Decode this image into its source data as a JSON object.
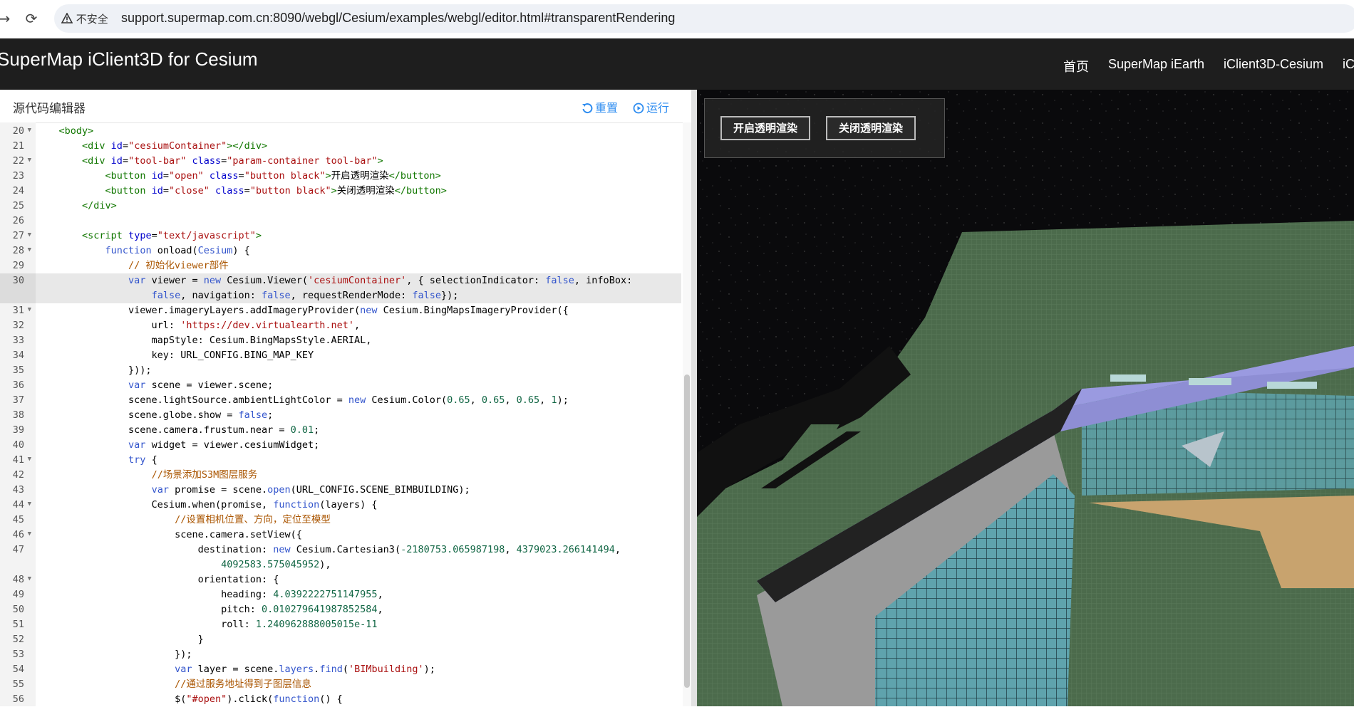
{
  "browser": {
    "security_label": "不安全",
    "url": "support.supermap.com.cn:8090/webgl/Cesium/examples/webgl/editor.html#transparentRendering"
  },
  "header": {
    "title": "SuperMap iClient3D for Cesium",
    "nav": [
      "首页",
      "SuperMap iEarth",
      "iClient3D-Cesium",
      "iC"
    ]
  },
  "editor": {
    "title": "源代码编辑器",
    "reset_label": "重置",
    "run_label": "运行",
    "gutter": [
      {
        "n": "20",
        "fold": true
      },
      {
        "n": "21",
        "fold": false
      },
      {
        "n": "22",
        "fold": true
      },
      {
        "n": "23",
        "fold": false
      },
      {
        "n": "24",
        "fold": false
      },
      {
        "n": "25",
        "fold": false
      },
      {
        "n": "26",
        "fold": false
      },
      {
        "n": "27",
        "fold": true
      },
      {
        "n": "28",
        "fold": true
      },
      {
        "n": "29",
        "fold": false
      },
      {
        "n": "30",
        "fold": false,
        "active": true
      },
      {
        "n": "",
        "fold": false,
        "active": true
      },
      {
        "n": "31",
        "fold": true
      },
      {
        "n": "32",
        "fold": false
      },
      {
        "n": "33",
        "fold": false
      },
      {
        "n": "34",
        "fold": false
      },
      {
        "n": "35",
        "fold": false
      },
      {
        "n": "36",
        "fold": false
      },
      {
        "n": "37",
        "fold": false
      },
      {
        "n": "38",
        "fold": false
      },
      {
        "n": "39",
        "fold": false
      },
      {
        "n": "40",
        "fold": false
      },
      {
        "n": "41",
        "fold": true
      },
      {
        "n": "42",
        "fold": false
      },
      {
        "n": "43",
        "fold": false
      },
      {
        "n": "44",
        "fold": true
      },
      {
        "n": "45",
        "fold": false
      },
      {
        "n": "46",
        "fold": true
      },
      {
        "n": "47",
        "fold": false
      },
      {
        "n": "",
        "fold": false
      },
      {
        "n": "48",
        "fold": true
      },
      {
        "n": "49",
        "fold": false
      },
      {
        "n": "50",
        "fold": false
      },
      {
        "n": "51",
        "fold": false
      },
      {
        "n": "52",
        "fold": false
      },
      {
        "n": "53",
        "fold": false
      },
      {
        "n": "54",
        "fold": false
      },
      {
        "n": "55",
        "fold": false
      },
      {
        "n": "56",
        "fold": false
      }
    ],
    "lines": [
      [
        [
          "t",
          "    "
        ],
        [
          "g",
          "<body>"
        ]
      ],
      [
        [
          "t",
          "        "
        ],
        [
          "g",
          "<div "
        ],
        [
          "b",
          "id"
        ],
        [
          "t",
          "="
        ],
        [
          "s",
          "\"cesiumContainer\""
        ],
        [
          "g",
          "></div>"
        ]
      ],
      [
        [
          "t",
          "        "
        ],
        [
          "g",
          "<div "
        ],
        [
          "b",
          "id"
        ],
        [
          "t",
          "="
        ],
        [
          "s",
          "\"tool-bar\""
        ],
        [
          "t",
          " "
        ],
        [
          "b",
          "class"
        ],
        [
          "t",
          "="
        ],
        [
          "s",
          "\"param-container tool-bar\""
        ],
        [
          "g",
          ">"
        ]
      ],
      [
        [
          "t",
          "            "
        ],
        [
          "g",
          "<button "
        ],
        [
          "b",
          "id"
        ],
        [
          "t",
          "="
        ],
        [
          "s",
          "\"open\""
        ],
        [
          "t",
          " "
        ],
        [
          "b",
          "class"
        ],
        [
          "t",
          "="
        ],
        [
          "s",
          "\"button black\""
        ],
        [
          "g",
          ">"
        ],
        [
          "t",
          "开启透明渲染"
        ],
        [
          "g",
          "</button>"
        ]
      ],
      [
        [
          "t",
          "            "
        ],
        [
          "g",
          "<button "
        ],
        [
          "b",
          "id"
        ],
        [
          "t",
          "="
        ],
        [
          "s",
          "\"close\""
        ],
        [
          "t",
          " "
        ],
        [
          "b",
          "class"
        ],
        [
          "t",
          "="
        ],
        [
          "s",
          "\"button black\""
        ],
        [
          "g",
          ">"
        ],
        [
          "t",
          "关闭透明渲染"
        ],
        [
          "g",
          "</button>"
        ]
      ],
      [
        [
          "t",
          "        "
        ],
        [
          "g",
          "</div>"
        ]
      ],
      [
        [
          "t",
          ""
        ]
      ],
      [
        [
          "t",
          "        "
        ],
        [
          "g",
          "<script "
        ],
        [
          "b",
          "type"
        ],
        [
          "t",
          "="
        ],
        [
          "s",
          "\"text/javascript\""
        ],
        [
          "g",
          ">"
        ]
      ],
      [
        [
          "t",
          "            "
        ],
        [
          "k",
          "function"
        ],
        [
          "t",
          " onload("
        ],
        [
          "k",
          "Cesium"
        ],
        [
          "t",
          ") {"
        ]
      ],
      [
        [
          "t",
          "                "
        ],
        [
          "c",
          "// 初始化viewer部件"
        ]
      ],
      [
        [
          "t",
          "                "
        ],
        [
          "k",
          "var"
        ],
        [
          "t",
          " viewer = "
        ],
        [
          "k",
          "new"
        ],
        [
          "t",
          " Cesium.Viewer("
        ],
        [
          "s",
          "'cesiumContainer'"
        ],
        [
          "t",
          ", { selectionIndicator: "
        ],
        [
          "k",
          "false"
        ],
        [
          "t",
          ", infoBox:"
        ]
      ],
      [
        [
          "t",
          "                    "
        ],
        [
          "k",
          "false"
        ],
        [
          "t",
          ", navigation: "
        ],
        [
          "k",
          "false"
        ],
        [
          "t",
          ", requestRenderMode: "
        ],
        [
          "k",
          "false"
        ],
        [
          "t",
          "});"
        ]
      ],
      [
        [
          "t",
          "                viewer.imageryLayers.addImageryProvider("
        ],
        [
          "k",
          "new"
        ],
        [
          "t",
          " Cesium.BingMapsImageryProvider({"
        ]
      ],
      [
        [
          "t",
          "                    url: "
        ],
        [
          "s",
          "'https://dev.virtualearth.net'"
        ],
        [
          "t",
          ","
        ]
      ],
      [
        [
          "t",
          "                    mapStyle: Cesium.BingMapsStyle.AERIAL,"
        ]
      ],
      [
        [
          "t",
          "                    key: URL_CONFIG.BING_MAP_KEY"
        ]
      ],
      [
        [
          "t",
          "                }));"
        ]
      ],
      [
        [
          "t",
          "                "
        ],
        [
          "k",
          "var"
        ],
        [
          "t",
          " scene = viewer.scene;"
        ]
      ],
      [
        [
          "t",
          "                scene.lightSource.ambientLightColor = "
        ],
        [
          "k",
          "new"
        ],
        [
          "t",
          " Cesium.Color("
        ],
        [
          "n",
          "0.65"
        ],
        [
          "t",
          ", "
        ],
        [
          "n",
          "0.65"
        ],
        [
          "t",
          ", "
        ],
        [
          "n",
          "0.65"
        ],
        [
          "t",
          ", "
        ],
        [
          "n",
          "1"
        ],
        [
          "t",
          ");"
        ]
      ],
      [
        [
          "t",
          "                scene.globe.show = "
        ],
        [
          "k",
          "false"
        ],
        [
          "t",
          ";"
        ]
      ],
      [
        [
          "t",
          "                scene.camera.frustum.near = "
        ],
        [
          "n",
          "0.01"
        ],
        [
          "t",
          ";"
        ]
      ],
      [
        [
          "t",
          "                "
        ],
        [
          "k",
          "var"
        ],
        [
          "t",
          " widget = viewer.cesiumWidget;"
        ]
      ],
      [
        [
          "t",
          "                "
        ],
        [
          "k",
          "try"
        ],
        [
          "t",
          " {"
        ]
      ],
      [
        [
          "t",
          "                    "
        ],
        [
          "c",
          "//场景添加S3M图层服务"
        ]
      ],
      [
        [
          "t",
          "                    "
        ],
        [
          "k",
          "var"
        ],
        [
          "t",
          " promise = scene."
        ],
        [
          "k",
          "open"
        ],
        [
          "t",
          "(URL_CONFIG.SCENE_BIMBUILDING);"
        ]
      ],
      [
        [
          "t",
          "                    Cesium.when(promise, "
        ],
        [
          "k",
          "function"
        ],
        [
          "t",
          "(layers) {"
        ]
      ],
      [
        [
          "t",
          "                        "
        ],
        [
          "c",
          "//设置相机位置、方向，定位至模型"
        ]
      ],
      [
        [
          "t",
          "                        scene.camera.setView({"
        ]
      ],
      [
        [
          "t",
          "                            destination: "
        ],
        [
          "k",
          "new"
        ],
        [
          "t",
          " Cesium.Cartesian3("
        ],
        [
          "n",
          "-2180753.065987198"
        ],
        [
          "t",
          ", "
        ],
        [
          "n",
          "4379023.266141494"
        ],
        [
          "t",
          ","
        ]
      ],
      [
        [
          "t",
          "                                "
        ],
        [
          "n",
          "4092583.575045952"
        ],
        [
          "t",
          "),"
        ]
      ],
      [
        [
          "t",
          "                            orientation: {"
        ]
      ],
      [
        [
          "t",
          "                                heading: "
        ],
        [
          "n",
          "4.0392222751147955"
        ],
        [
          "t",
          ","
        ]
      ],
      [
        [
          "t",
          "                                pitch: "
        ],
        [
          "n",
          "0.010279641987852584"
        ],
        [
          "t",
          ","
        ]
      ],
      [
        [
          "t",
          "                                roll: "
        ],
        [
          "n",
          "1.240962888005015e-11"
        ]
      ],
      [
        [
          "t",
          "                            }"
        ]
      ],
      [
        [
          "t",
          "                        });"
        ]
      ],
      [
        [
          "t",
          "                        "
        ],
        [
          "k",
          "var"
        ],
        [
          "t",
          " layer = scene."
        ],
        [
          "k",
          "layers"
        ],
        [
          "t",
          "."
        ],
        [
          "k",
          "find"
        ],
        [
          "t",
          "("
        ],
        [
          "s",
          "'BIMbuilding'"
        ],
        [
          "t",
          ");"
        ]
      ],
      [
        [
          "t",
          "                        "
        ],
        [
          "c",
          "//通过服务地址得到子图层信息"
        ]
      ],
      [
        [
          "t",
          "                        $("
        ],
        [
          "s",
          "\"#open\""
        ],
        [
          "t",
          ").click("
        ],
        [
          "k",
          "function"
        ],
        [
          "t",
          "() {"
        ]
      ]
    ]
  },
  "scene": {
    "open_button": "开启透明渲染",
    "close_button": "关闭透明渲染"
  },
  "colors": {
    "tag": "#117700",
    "attr": "#0000cc",
    "string": "#aa1111",
    "keyword": "#3355cc",
    "comment": "#aa5500",
    "number": "#116644",
    "roof": "#8e8ed4",
    "ground": "#4b6e4b"
  }
}
